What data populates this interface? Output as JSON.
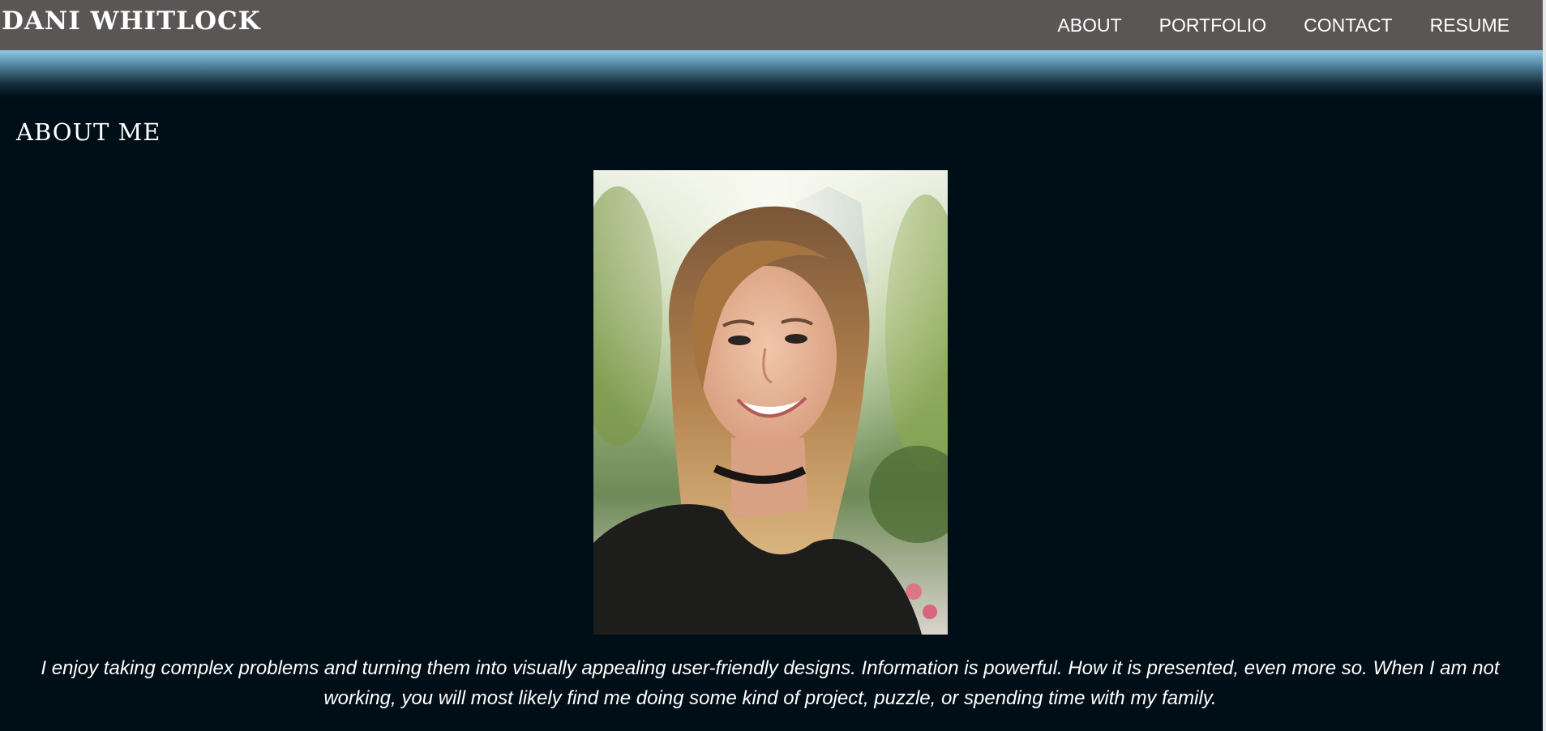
{
  "header": {
    "brand": "DANI WHITLOCK",
    "nav": [
      {
        "label": "ABOUT"
      },
      {
        "label": "PORTFOLIO"
      },
      {
        "label": "CONTACT"
      },
      {
        "label": "RESUME"
      }
    ]
  },
  "about": {
    "title": "ABOUT ME",
    "bio": "I enjoy taking complex problems and turning them into visually appealing user-friendly designs. Information is powerful. How it is presented, even more so. When I am not working, you will most likely find me doing some kind of project, puzzle, or spending time with my family."
  },
  "colors": {
    "navbar": "#5a5656",
    "page_background": "#000e18",
    "banner_top": "#8ec8e8",
    "text": "#ffffff"
  }
}
